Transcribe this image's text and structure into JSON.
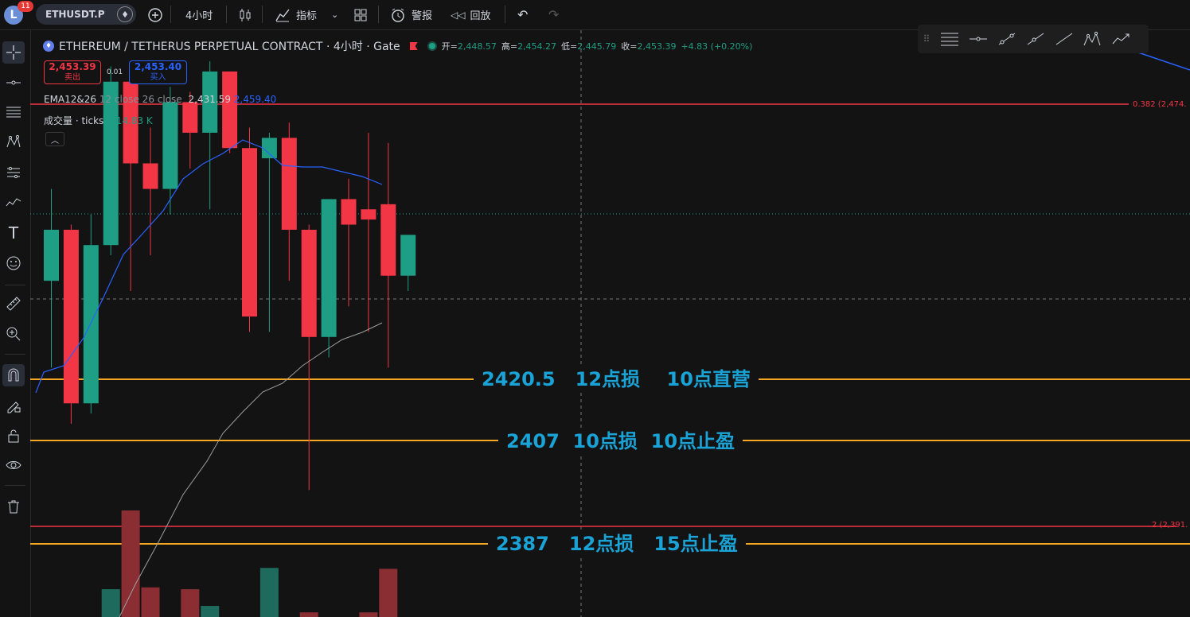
{
  "topbar": {
    "avatar_letter": "L",
    "notification_count": "11",
    "symbol": "ETHUSDT.P",
    "interval": "4小时",
    "indicators_label": "指标",
    "alert_label": "警报",
    "replay_label": "回放"
  },
  "legend": {
    "title": "ETHEREUM / TETHERUS PERPETUAL CONTRACT · 4小时 · Gate",
    "open_label": "开=",
    "open": "2,448.57",
    "high_label": "高=",
    "high": "2,454.27",
    "low_label": "低=",
    "low": "2,445.79",
    "close_label": "收=",
    "close": "2,453.39",
    "change": "+4.83 (+0.20%)"
  },
  "trade": {
    "sell_price": "2,453.39",
    "sell_label": "卖出",
    "spread": "0.01",
    "buy_price": "2,453.40",
    "buy_label": "买入"
  },
  "indicators": {
    "ema_name": "EMA12&26",
    "ema_params": "12 close 26 close",
    "ema1_value": "2,431.59",
    "ema2_value": "2,459.40",
    "volume_name": "成交量 · ticks",
    "volume_value": "914.83 K"
  },
  "right_labels": {
    "fib_382": "0.382 (2,474.",
    "fib_2": "2 (2,391."
  },
  "annotations": {
    "line1": "2420.5   12点损    10点直营",
    "line2": "2407  10点损  10点止盈",
    "line3": "2387   12点损   15点止盈"
  },
  "colors": {
    "up": "#1e9e84",
    "down": "#f23645",
    "ema_fast": "#2962ff",
    "ema_slow": "#9e9e9e",
    "fib": "#f23645",
    "orange": "#f5a623",
    "annotation": "#1aa3d6"
  },
  "sidebar_icons": [
    "crosshair-icon",
    "horizontal-ray-icon",
    "fib-icon",
    "pattern-icon",
    "projection-icon",
    "brush-icon",
    "text-icon",
    "emoji-icon",
    "ruler-icon",
    "zoom-in-icon",
    "magnet-icon",
    "lock-drawing-icon",
    "unlock-icon",
    "eye-icon",
    "trash-icon"
  ],
  "candles": [
    {
      "o": 2440,
      "h": 2458,
      "l": 2423,
      "c": 2450,
      "v": 0
    },
    {
      "o": 2450,
      "h": 2451,
      "l": 2412,
      "c": 2416,
      "v": 0
    },
    {
      "o": 2416,
      "h": 2453,
      "l": 2414,
      "c": 2447,
      "v": 0
    },
    {
      "o": 2447,
      "h": 2482,
      "l": 2445,
      "c": 2479,
      "v": 300
    },
    {
      "o": 2479,
      "h": 2483,
      "l": 2438,
      "c": 2463,
      "v": 1150
    },
    {
      "o": 2463,
      "h": 2470,
      "l": 2445,
      "c": 2458,
      "v": 320
    },
    {
      "o": 2458,
      "h": 2478,
      "l": 2453,
      "c": 2475,
      "v": 0
    },
    {
      "o": 2475,
      "h": 2477,
      "l": 2462,
      "c": 2469,
      "v": 300
    },
    {
      "o": 2469,
      "h": 2483,
      "l": 2454,
      "c": 2481,
      "v": 120
    },
    {
      "o": 2481,
      "h": 2481,
      "l": 2465,
      "c": 2466,
      "v": 0
    },
    {
      "o": 2466,
      "h": 2470,
      "l": 2430,
      "c": 2433,
      "v": 0
    },
    {
      "o": 2464,
      "h": 2469,
      "l": 2430,
      "c": 2468,
      "v": 530
    },
    {
      "o": 2468,
      "h": 2471,
      "l": 2440,
      "c": 2450,
      "v": 0
    },
    {
      "o": 2450,
      "h": 2451,
      "l": 2399,
      "c": 2429,
      "v": 50
    },
    {
      "o": 2429,
      "h": 2456,
      "l": 2425,
      "c": 2456,
      "v": 0
    },
    {
      "o": 2456,
      "h": 2460,
      "l": 2435,
      "c": 2451,
      "v": 0
    },
    {
      "o": 2454,
      "h": 2469,
      "l": 2430,
      "c": 2452,
      "v": 50
    },
    {
      "o": 2455,
      "h": 2467,
      "l": 2423,
      "c": 2441,
      "v": 520
    },
    {
      "o": 2441,
      "h": 2445,
      "l": 2438,
      "c": 2449,
      "v": 0
    }
  ]
}
